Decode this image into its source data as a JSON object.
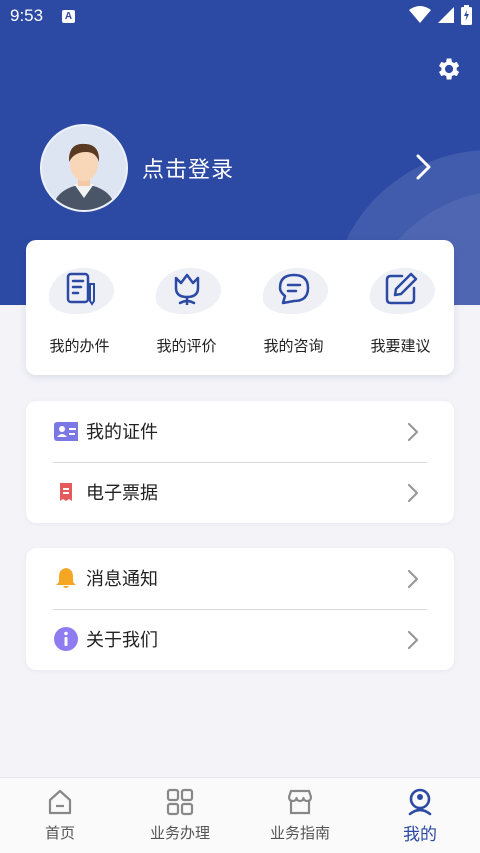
{
  "status_bar": {
    "time": "9:53",
    "notification_badge": "A"
  },
  "header": {
    "login_text": "点击登录"
  },
  "quick_actions": [
    {
      "label": "我的办件",
      "icon": "document-pen-icon"
    },
    {
      "label": "我的评价",
      "icon": "tulip-icon"
    },
    {
      "label": "我的咨询",
      "icon": "chat-bubble-icon"
    },
    {
      "label": "我要建议",
      "icon": "edit-square-icon"
    }
  ],
  "menu_groups": [
    [
      {
        "label": "我的证件",
        "icon": "id-card-icon",
        "color": "#7b78e6"
      },
      {
        "label": "电子票据",
        "icon": "receipt-icon",
        "color": "#e55a5a"
      }
    ],
    [
      {
        "label": "消息通知",
        "icon": "bell-icon",
        "color": "#f5a623"
      },
      {
        "label": "关于我们",
        "icon": "info-icon",
        "color": "#8e7cf0"
      }
    ]
  ],
  "tabs": [
    {
      "label": "首页",
      "icon": "home-icon"
    },
    {
      "label": "业务办理",
      "icon": "grid-icon"
    },
    {
      "label": "业务指南",
      "icon": "store-icon"
    },
    {
      "label": "我的",
      "icon": "user-icon",
      "active": true
    }
  ],
  "colors": {
    "primary": "#2c49a4",
    "background": "#f3f3f8"
  }
}
